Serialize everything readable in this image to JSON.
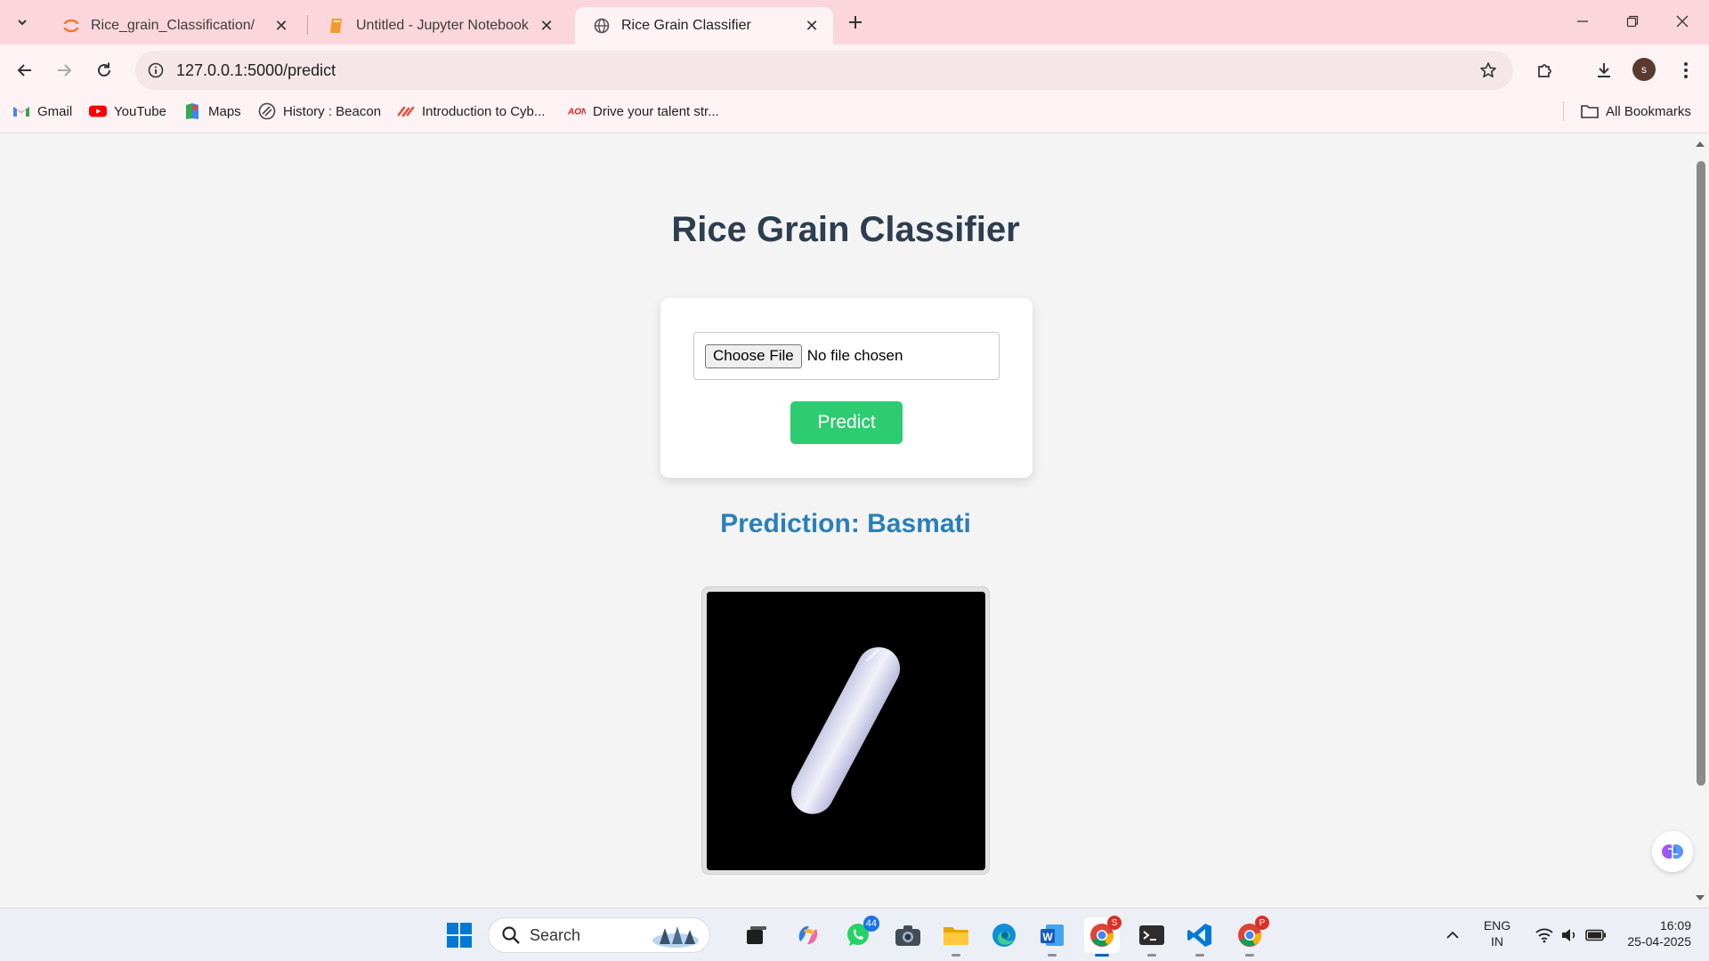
{
  "browser": {
    "tabs": [
      {
        "title": "Rice_grain_Classification/",
        "active": false
      },
      {
        "title": "Untitled - Jupyter Notebook",
        "active": false
      },
      {
        "title": "Rice Grain Classifier",
        "active": true
      }
    ],
    "url": "127.0.0.1:5000/predict",
    "profile_initial": "s",
    "bookmarks": [
      {
        "label": "Gmail",
        "icon": "gmail-icon"
      },
      {
        "label": "YouTube",
        "icon": "youtube-icon"
      },
      {
        "label": "Maps",
        "icon": "maps-icon"
      },
      {
        "label": "History : Beacon",
        "icon": "beacon-icon"
      },
      {
        "label": "Introduction to Cyb...",
        "icon": "cyber-icon"
      },
      {
        "label": "Drive your talent str...",
        "icon": "aon-icon"
      }
    ],
    "all_bookmarks_label": "All Bookmarks"
  },
  "page": {
    "heading": "Rice Grain Classifier",
    "form": {
      "choose_file_label": "Choose File",
      "file_status": "No file chosen",
      "predict_label": "Predict"
    },
    "prediction_text": "Prediction: Basmati",
    "image_alt": "rice grain"
  },
  "taskbar": {
    "search_label": "Search",
    "whatsapp_badge": "44",
    "chrome_badge": "S",
    "chrome2_badge": "P",
    "language": "ENG",
    "region": "IN",
    "time": "16:09",
    "date": "25-04-2025"
  },
  "colors": {
    "heading": "#2c3e50",
    "predict_button": "#2ecc71",
    "prediction_text": "#2980b9",
    "tabstrip": "#fbd6dd"
  }
}
